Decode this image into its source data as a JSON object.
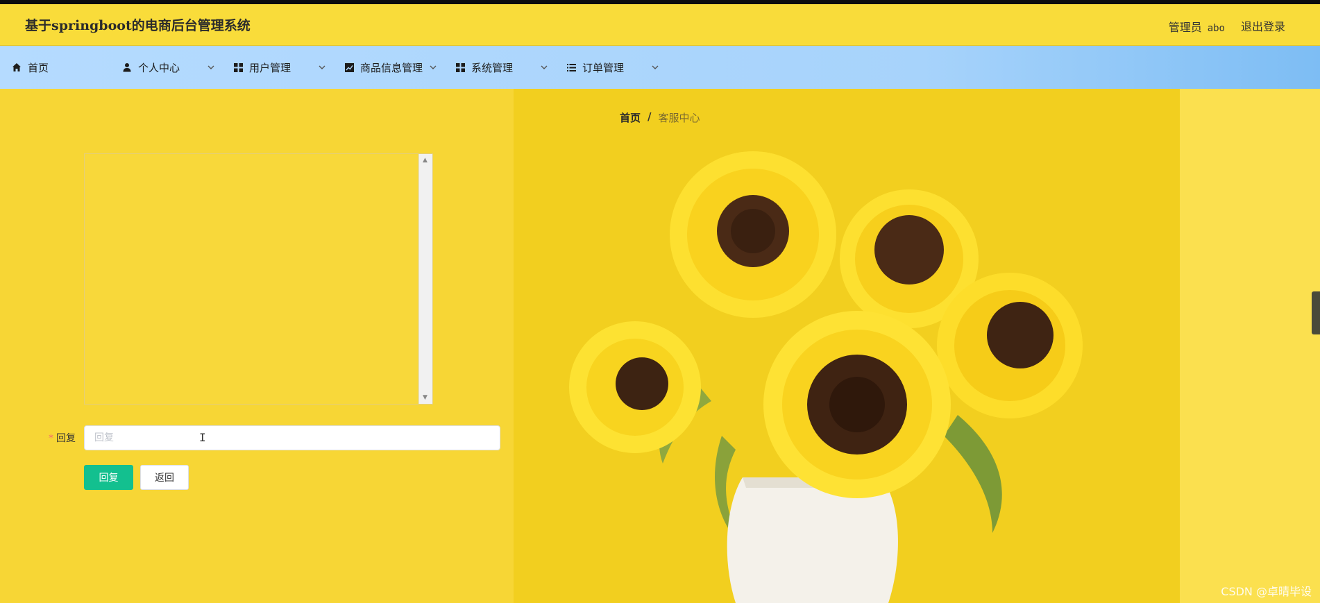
{
  "header": {
    "title": "基于springboot的电商后台管理系统",
    "user_role": "管理员",
    "user_name": "abo",
    "logout_label": "退出登录"
  },
  "nav": {
    "items": [
      {
        "label": "首页",
        "icon": "home-icon",
        "has_dropdown": false
      },
      {
        "label": "个人中心",
        "icon": "user-icon",
        "has_dropdown": true
      },
      {
        "label": "用户管理",
        "icon": "grid-icon",
        "has_dropdown": true
      },
      {
        "label": "商品信息管理",
        "icon": "chart-icon",
        "has_dropdown": true
      },
      {
        "label": "系统管理",
        "icon": "grid-icon",
        "has_dropdown": true
      },
      {
        "label": "订单管理",
        "icon": "list-icon",
        "has_dropdown": true
      }
    ]
  },
  "breadcrumb": {
    "home": "首页",
    "separator": "/",
    "current": "客服中心"
  },
  "form": {
    "reply_label": "回复",
    "reply_required_mark": "*",
    "reply_placeholder": "回复",
    "reply_value": "",
    "submit_label": "回复",
    "back_label": "返回"
  },
  "watermark": "CSDN @卓晴毕设",
  "colors": {
    "header_bg": "#f9dc3a",
    "nav_bg": "#b5dbff",
    "primary_button": "#13c08f",
    "page_bg": "#f7d635"
  }
}
